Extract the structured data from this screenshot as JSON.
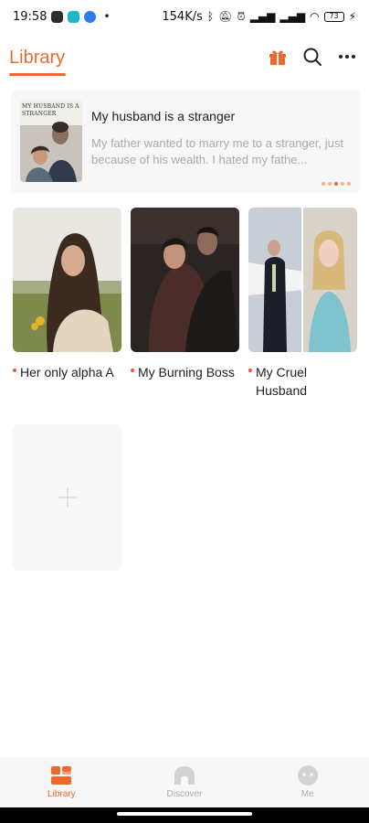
{
  "status_bar": {
    "time": "19:58",
    "net_speed": "154K/s",
    "battery": "73"
  },
  "header": {
    "title": "Library",
    "icons": [
      "gift-icon",
      "search-icon",
      "more-icon"
    ]
  },
  "featured": {
    "cover_text": "MY HUSBAND IS A STRANGER",
    "title": "My husband is a stranger",
    "description": "My father wanted to marry me to a stranger, just because of his wealth. I hated my fathe..."
  },
  "books": [
    {
      "title": "Her only alpha A"
    },
    {
      "title": "My Burning Boss"
    },
    {
      "title": "My Cruel Husband"
    }
  ],
  "bottom_nav": {
    "items": [
      {
        "label": "Library",
        "active": true
      },
      {
        "label": "Discover",
        "active": false
      },
      {
        "label": "Me",
        "active": false
      }
    ]
  },
  "colors": {
    "accent": "#ee6a2c",
    "muted": "#cfcfcf"
  }
}
